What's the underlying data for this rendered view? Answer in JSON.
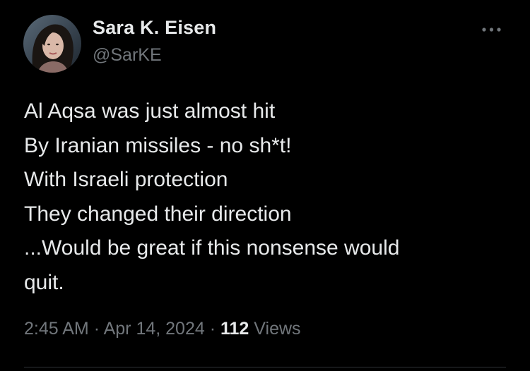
{
  "author": {
    "name": "Sara K. Eisen",
    "handle": "@SarKE",
    "avatar_icon": "profile-photo"
  },
  "menu": {
    "icon": "more-horizontal-icon"
  },
  "tweet": {
    "lines": [
      "Al Aqsa was just almost hit",
      "By Iranian missiles - no sh*t!",
      "With Israeli protection",
      "They changed their direction",
      "...Would be great if this nonsense would",
      "quit."
    ]
  },
  "meta": {
    "time": "2:45 AM",
    "separator": "·",
    "date": "Apr 14, 2024",
    "views_count": "112",
    "views_label": "Views"
  },
  "colors": {
    "background": "#000000",
    "primary_text": "#e7e9ea",
    "secondary_text": "#71767b",
    "divider": "#2f3336"
  }
}
